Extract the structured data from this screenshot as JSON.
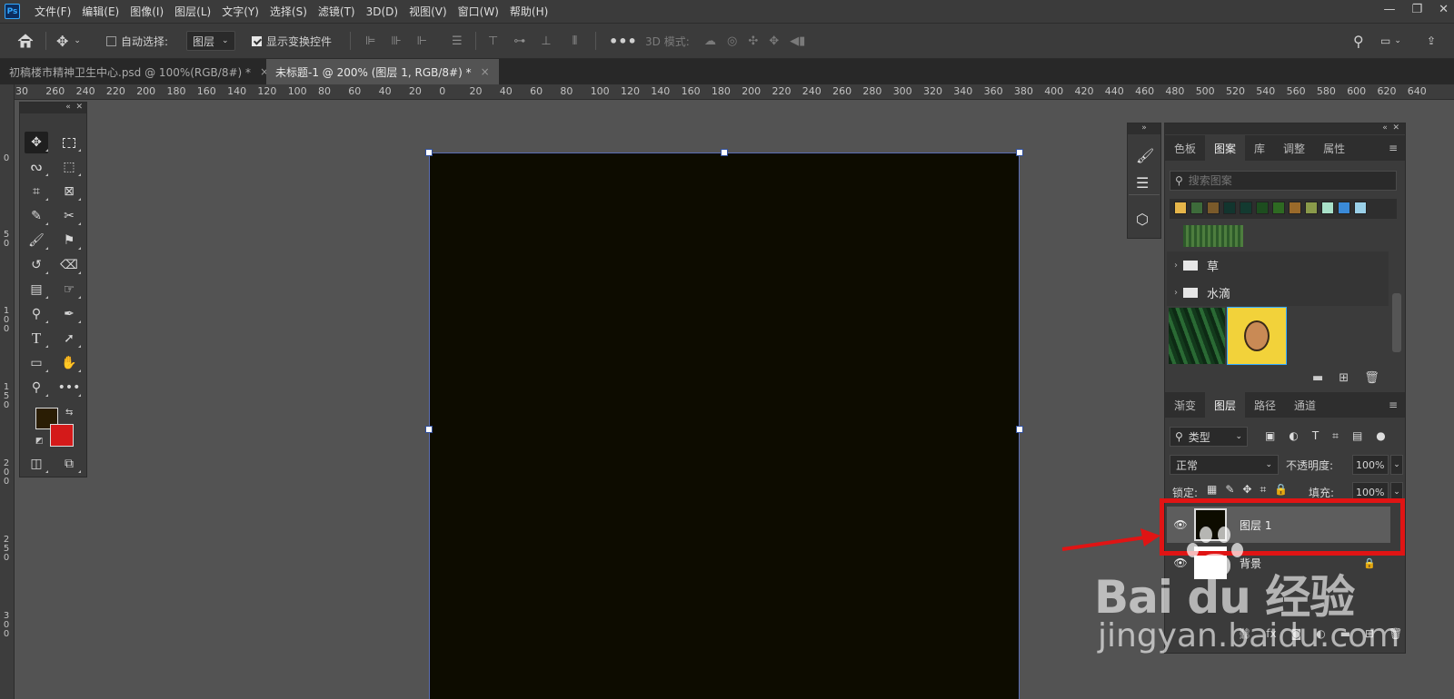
{
  "app": {
    "logo": "Ps"
  },
  "menubar": {
    "items": [
      "文件(F)",
      "编辑(E)",
      "图像(I)",
      "图层(L)",
      "文字(Y)",
      "选择(S)",
      "滤镜(T)",
      "3D(D)",
      "视图(V)",
      "窗口(W)",
      "帮助(H)"
    ]
  },
  "options": {
    "auto_select_label": "自动选择:",
    "auto_select_value": "图层",
    "show_transform_label": "显示变换控件",
    "mode3d_label": "3D 模式:"
  },
  "tabs": [
    {
      "title": "初稿楼市精神卫生中心.psd @ 100%(RGB/8#) *",
      "close": "×"
    },
    {
      "title": "未标题-1 @ 200% (图层 1, RGB/8#) *",
      "close": "×"
    }
  ],
  "ruler": {
    "h": [
      "30",
      "260",
      "240",
      "220",
      "200",
      "180",
      "160",
      "140",
      "120",
      "100",
      "80",
      "60",
      "40",
      "20",
      "0",
      "20",
      "40",
      "60",
      "80",
      "100",
      "120",
      "140",
      "160",
      "180",
      "200",
      "220",
      "240",
      "260",
      "280",
      "300",
      "320",
      "340",
      "360",
      "380",
      "400",
      "420",
      "440",
      "460",
      "480",
      "500",
      "520",
      "540",
      "560",
      "580",
      "600",
      "620",
      "640"
    ],
    "v": [
      "0",
      "5 0",
      "1 0 0",
      "1 5 0",
      "2 0 0",
      "2 5 0",
      "3 0 0"
    ]
  },
  "colors": {
    "foreground": "#2a1d04",
    "background": "#d41a1a",
    "canvas": "#0d0c00"
  },
  "patterns_panel": {
    "tabs": [
      "色板",
      "图案",
      "库",
      "调整",
      "属性"
    ],
    "active": "图案",
    "search_placeholder": "搜索图案",
    "folders": [
      "草",
      "水滴"
    ]
  },
  "layers_panel": {
    "tabs": [
      "渐变",
      "图层",
      "路径",
      "通道"
    ],
    "active": "图层",
    "filter_label": "类型",
    "blend_mode": "正常",
    "opacity_label": "不透明度:",
    "opacity": "100%",
    "lock_label": "锁定:",
    "fill_label": "填充:",
    "fill": "100%",
    "layers": [
      {
        "name": "图层 1",
        "selected": true
      },
      {
        "name": "背景",
        "locked": true
      }
    ]
  },
  "watermark": {
    "brand": "Bai du 经验",
    "url": "jingyan.baidu.com"
  }
}
